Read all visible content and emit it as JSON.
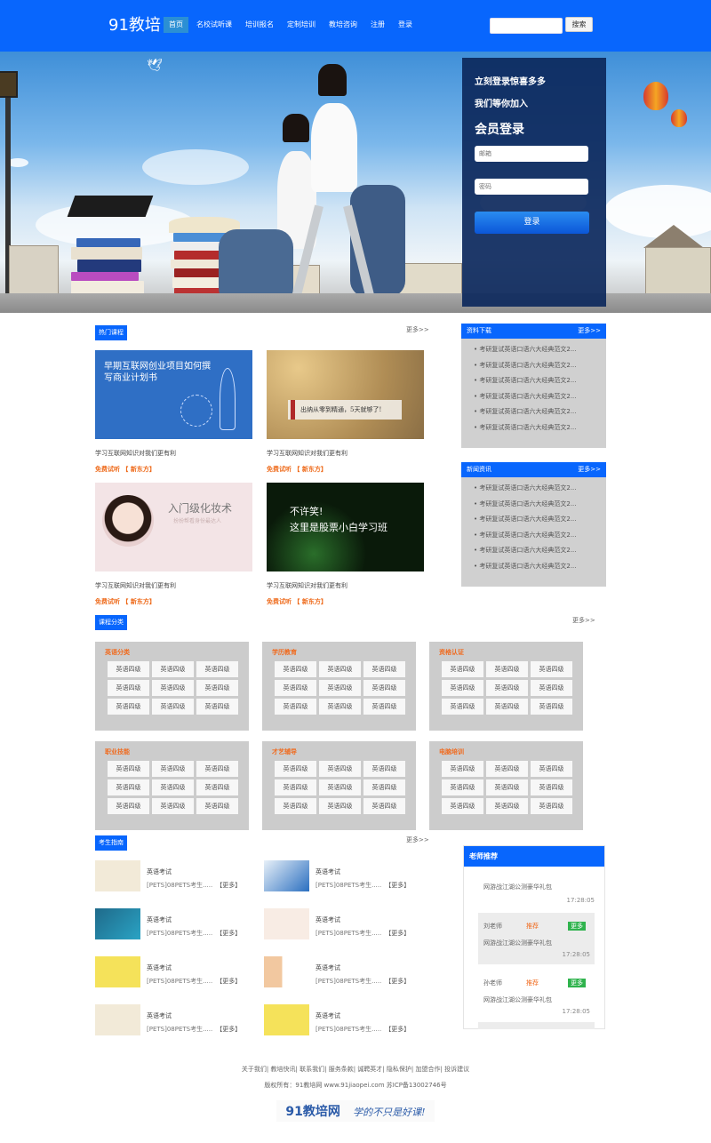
{
  "header": {
    "logo": "91教培",
    "nav": [
      "首页",
      "名校试听课",
      "培训报名",
      "定制培训",
      "教培咨询",
      "注册",
      "登录"
    ],
    "active_index": 0,
    "search_placeholder": "",
    "search_button": "搜索"
  },
  "login": {
    "line1": "立刻登录惊喜多多",
    "line2": "我们等你加入",
    "title": "会员登录",
    "email_placeholder": "邮箱",
    "password_placeholder": "密码",
    "button": "登录"
  },
  "hot": {
    "tag": "热门课程",
    "more": "更多>>",
    "courses": [
      {
        "thumb_text": "早期互联网创业项目如何撰写商业计划书",
        "title": "学习互联网知识对我们更有利",
        "sub": "免费试听 【 新东方】"
      },
      {
        "thumb_text": "出纳从零到精通，5天就够了!",
        "title": "学习互联网知识对我们更有利",
        "sub": "免费试听 【 新东方】"
      },
      {
        "thumb_text": "入门级化妆术",
        "thumb_sub": "扮扮帮看身份最达人",
        "title": "学习互联网知识对我们更有利",
        "sub": "免费试听 【 新东方】"
      },
      {
        "thumb_text": "不许笑!",
        "thumb_text2": "这里是股票小白学习班",
        "title": "学习互联网知识对我们更有利",
        "sub": "免费试听 【 新东方】"
      }
    ]
  },
  "downloads": {
    "title": "资料下载",
    "more": "更多>>",
    "items": [
      "考研复试英语口语六大经典范文2...",
      "考研复试英语口语六大经典范文2...",
      "考研复试英语口语六大经典范文2...",
      "考研复试英语口语六大经典范文2...",
      "考研复试英语口语六大经典范文2...",
      "考研复试英语口语六大经典范文2..."
    ]
  },
  "news": {
    "title": "新闻资讯",
    "more": "更多>>",
    "items": [
      "考研复试英语口语六大经典范文2...",
      "考研复试英语口语六大经典范文2...",
      "考研复试英语口语六大经典范文2...",
      "考研复试英语口语六大经典范文2...",
      "考研复试英语口语六大经典范文2...",
      "考研复试英语口语六大经典范文2..."
    ]
  },
  "categories": {
    "tag": "课程分类",
    "more": "更多>>",
    "cell": "英语四级",
    "groups": [
      "英语分类",
      "学历教育",
      "资格认证",
      "职业技能",
      "才艺辅导",
      "电脑培训"
    ]
  },
  "guide": {
    "tag": "考生指南",
    "more": "更多>>",
    "item_title": "英语考试",
    "item_desc": "[PETS]08PETS考生.....",
    "item_more": "【更多】"
  },
  "teacher": {
    "title": "老师推荐",
    "items": [
      {
        "name": "",
        "tag": "",
        "more": "",
        "text": "网游战江湖公测豪华礼包",
        "time": "17:28:05"
      },
      {
        "name": "刘老师",
        "tag": "推荐",
        "more": "更多",
        "text": "网游战江湖公测豪华礼包",
        "time": "17:28:05"
      },
      {
        "name": "孙老师",
        "tag": "推荐",
        "more": "更多",
        "text": "网游战江湖公测豪华礼包",
        "time": "17:28:05"
      }
    ]
  },
  "footer": {
    "links": [
      "关于我们",
      "教培快讯",
      "联系我们",
      "服务条款",
      "诚聘英才",
      "隐私保护",
      "加盟合作",
      "投诉建议"
    ],
    "copyright": "版权所有：91教培网 www.91jiaopei.com 苏ICP备13002746号",
    "brand": "91教培网",
    "slogan": "学的不只是好课!"
  }
}
